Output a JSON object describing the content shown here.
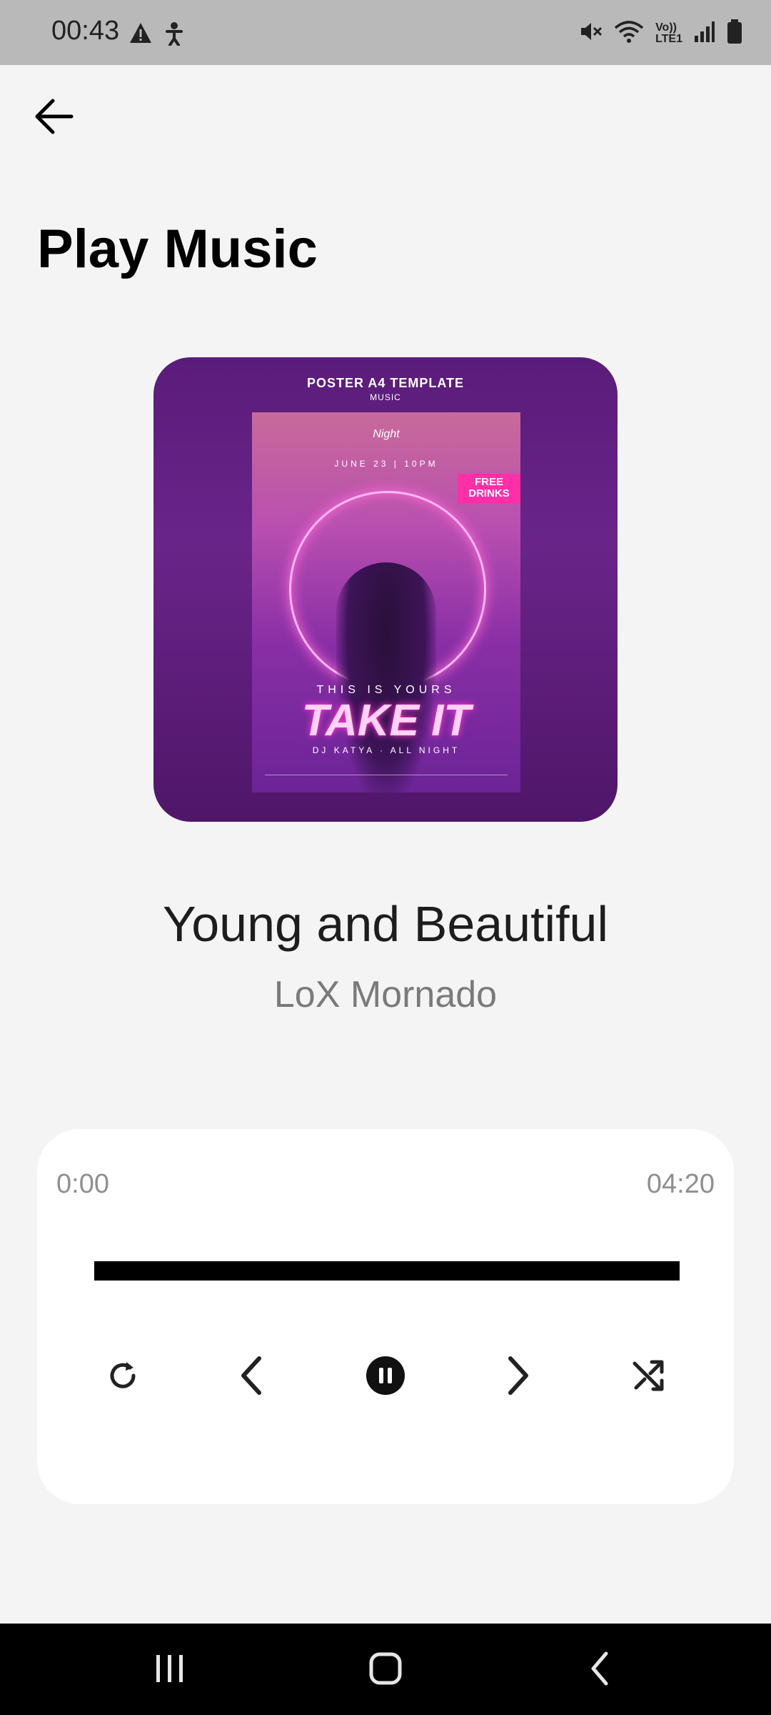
{
  "status_bar": {
    "time": "00:43",
    "left_icons": [
      "warning-icon",
      "accessibility-icon"
    ],
    "right_icons": [
      "mute-icon",
      "wifi-icon",
      "volte-lte-icon",
      "signal-icon",
      "battery-icon"
    ],
    "network_label_top": "Vo))",
    "network_label_bottom": "LTE1"
  },
  "header": {
    "title": "Play Music"
  },
  "artwork": {
    "top_line1": "POSTER A4 TEMPLATE",
    "top_line2": "MUSIC",
    "night": "Night",
    "date": "JUNE 23  |  10PM",
    "free": "FREE",
    "drinks": "DRINKS",
    "this_is_yours": "THIS IS YOURS",
    "take_it": "TAKE IT",
    "dj": "DJ KATYA · ALL NIGHT"
  },
  "track": {
    "title": "Young and Beautiful",
    "artist": "LoX Mornado"
  },
  "player": {
    "current_time": "0:00",
    "total_time": "04:20",
    "progress": 1.0,
    "controls": [
      "repeat-icon",
      "previous-icon",
      "pause-icon",
      "next-icon",
      "shuffle-icon"
    ]
  },
  "navigation": [
    "recent-apps-icon",
    "home-icon",
    "back-icon"
  ]
}
